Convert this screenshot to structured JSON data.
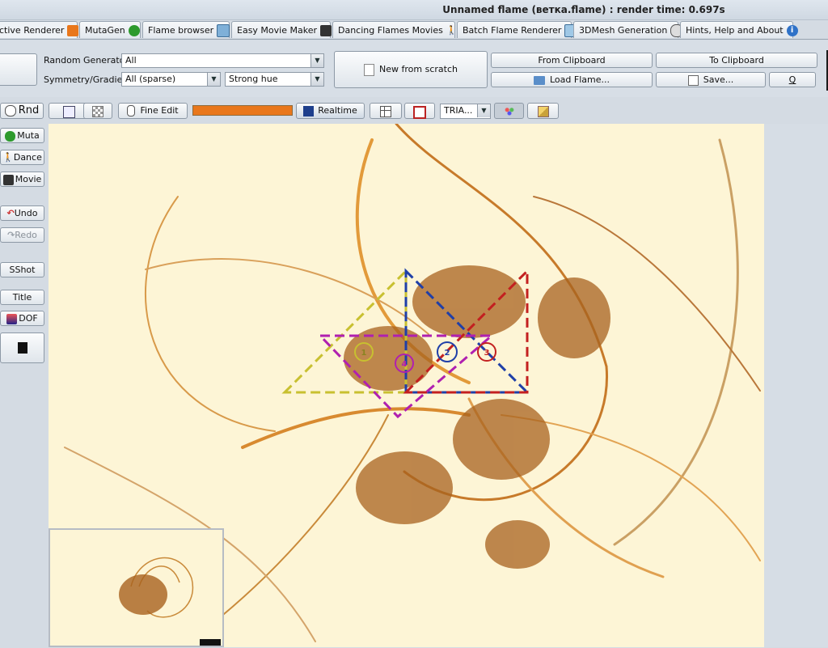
{
  "window": {
    "title": "Unnamed flame (ветка.flame) : render time: 0.697s"
  },
  "tabs": [
    {
      "label": "ctive Renderer",
      "icon": "arrow-icon",
      "active": false
    },
    {
      "label": "MutaGen",
      "icon": "tree-icon"
    },
    {
      "label": "Flame browser",
      "icon": "grid-icon"
    },
    {
      "label": "Easy Movie Maker",
      "icon": "clapper-icon"
    },
    {
      "label": "Dancing Flames Movies",
      "icon": "dancer-icon"
    },
    {
      "label": "Batch Flame Renderer",
      "icon": "stack-icon"
    },
    {
      "label": "3DMesh Generation",
      "icon": "ball-icon"
    },
    {
      "label": "Hints, Help and About",
      "icon": "info-icon"
    }
  ],
  "generator": {
    "random_label": "Random Generator",
    "random_value": "All",
    "symmetry_label": "Symmetry/Gradient",
    "symmetry_value": "All (sparse)",
    "gradient_value": "Strong hue"
  },
  "actions": {
    "new_from_scratch": "New from scratch",
    "from_clipboard": "From Clipboard",
    "to_clipboard": "To Clipboard",
    "load_flame": "Load Flame...",
    "save": "Save...",
    "q": "Q"
  },
  "toolbar2": {
    "rnd": "Rnd",
    "fine_edit": "Fine Edit",
    "realtime": "Realtime",
    "tria": "TRIA..."
  },
  "side": {
    "muta": "Muta",
    "dance": "Dance",
    "movie": "Movie",
    "undo": "Undo",
    "redo": "Redo",
    "sshot": "SShot",
    "title": "Title",
    "dof": "DOF"
  },
  "triangles": {
    "labels": [
      "1",
      "2",
      "3",
      "4"
    ]
  },
  "colors": {
    "accent_orange": "#e9771b",
    "canvas_bg": "#fdf5d6",
    "flame_brown": "#a8621e"
  }
}
